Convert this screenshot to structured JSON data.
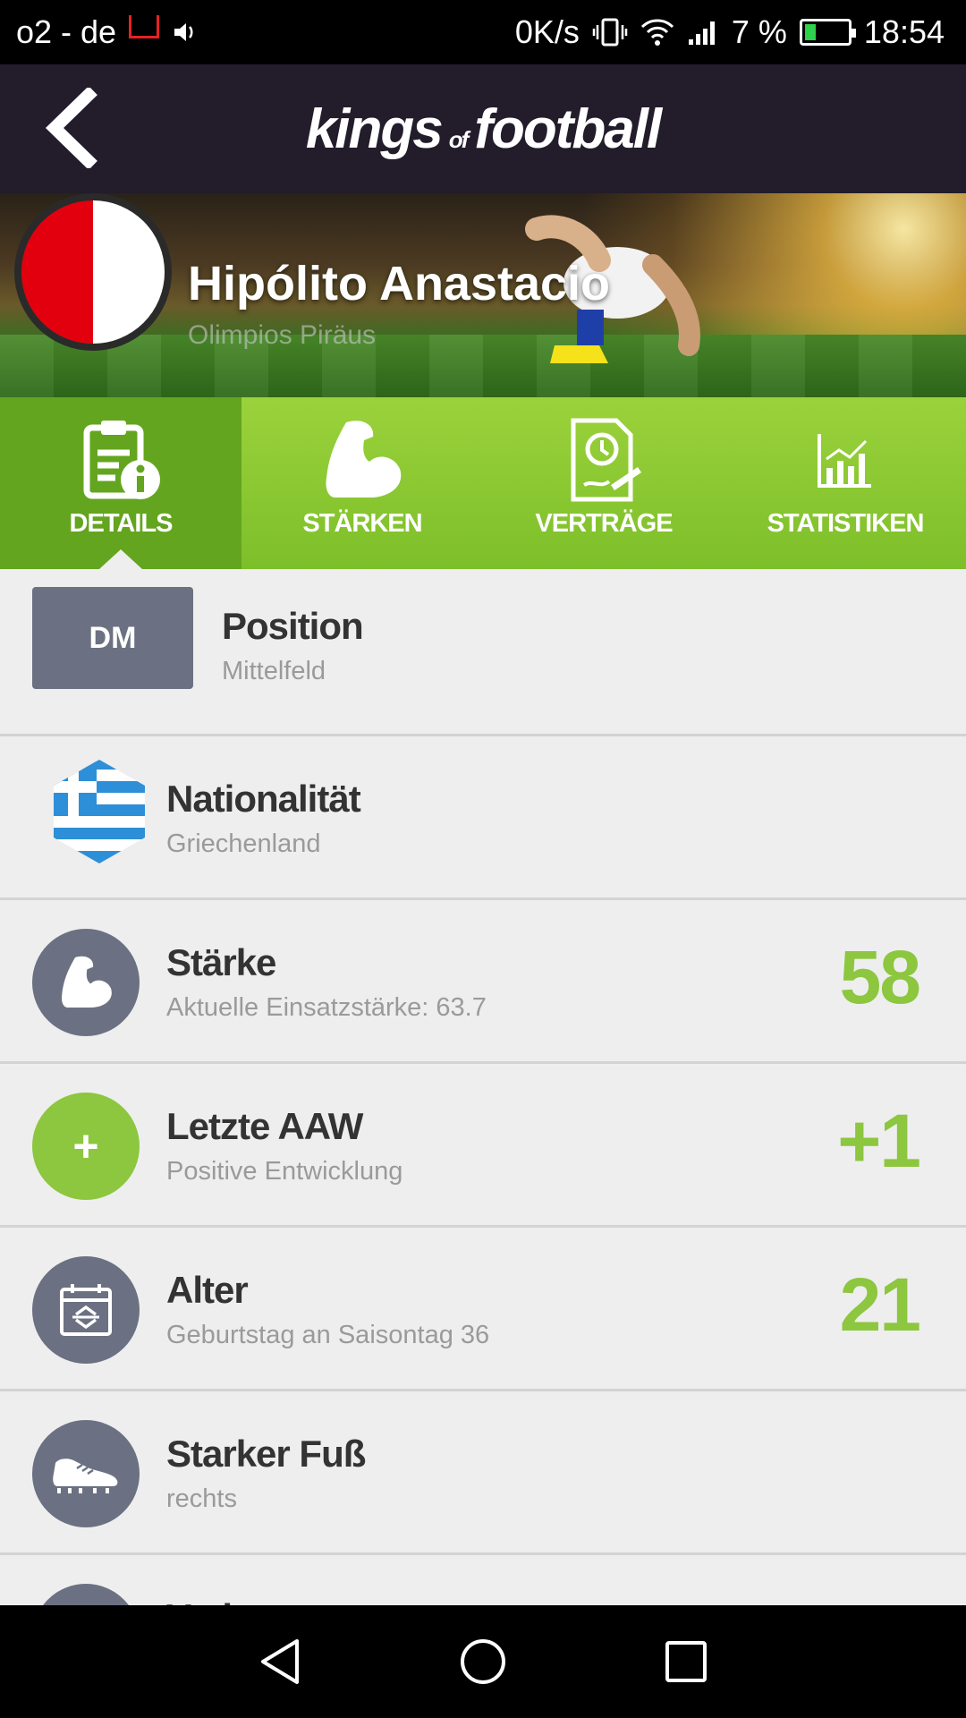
{
  "status_bar": {
    "carrier": "o2 - de",
    "speed": "0K/s",
    "battery": "7 %",
    "time": "18:54"
  },
  "header": {
    "logo_kings": "kings",
    "logo_of": "of",
    "logo_football": "football"
  },
  "player": {
    "name": "Hipólito Anastacio",
    "club": "Olimpios Piräus"
  },
  "tabs": [
    {
      "label": "DETAILS",
      "active": true
    },
    {
      "label": "STÄRKEN"
    },
    {
      "label": "VERTRÄGE"
    },
    {
      "label": "STATISTIKEN"
    }
  ],
  "rows": {
    "position": {
      "chip": "DM",
      "title": "Position",
      "sub": "Mittelfeld"
    },
    "nationality": {
      "title": "Nationalität",
      "sub": "Griechenland"
    },
    "strength": {
      "title": "Stärke",
      "sub": "Aktuelle Einsatzstärke: 63.7",
      "value": "58"
    },
    "aaw": {
      "title": "Letzte AAW",
      "sub": "Positive Entwicklung",
      "value": "+1",
      "badge": "+"
    },
    "age": {
      "title": "Alter",
      "sub": "Geburtstag an Saisontag 36",
      "value": "21"
    },
    "foot": {
      "title": "Starker Fuß",
      "sub": "rechts"
    },
    "injury": {
      "title": "Verletzung"
    }
  },
  "colors": {
    "accent_green": "#8dc63f",
    "header_bg": "#221c2b",
    "icon_bg": "#6b7182"
  }
}
